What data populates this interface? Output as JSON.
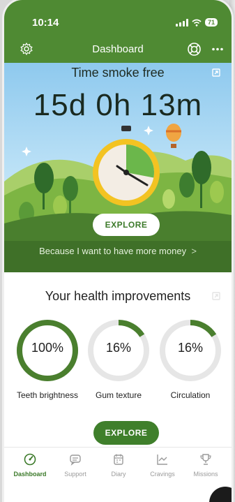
{
  "status_bar": {
    "time": "10:14",
    "battery": "71"
  },
  "header": {
    "title": "Dashboard"
  },
  "hero": {
    "title": "Time smoke free",
    "counter": "15d 0h 13m",
    "explore_label": "EXPLORE",
    "reason": "Because I want to have more money",
    "stopwatch_progress": 0.28
  },
  "health": {
    "title": "Your health improvements",
    "items": [
      {
        "value": "100%",
        "label": "Teeth brightness",
        "progress": 1.0
      },
      {
        "value": "16%",
        "label": "Gum texture",
        "progress": 0.16
      },
      {
        "value": "16%",
        "label": "Circulation",
        "progress": 0.16
      }
    ],
    "explore_label": "EXPLORE"
  },
  "nav": {
    "items": [
      {
        "label": "Dashboard",
        "icon": "dashboard-icon",
        "active": true
      },
      {
        "label": "Support",
        "icon": "chat-icon",
        "active": false
      },
      {
        "label": "Diary",
        "icon": "calendar-icon",
        "active": false
      },
      {
        "label": "Cravings",
        "icon": "chart-icon",
        "active": false
      },
      {
        "label": "Missions",
        "icon": "trophy-icon",
        "active": false
      }
    ]
  },
  "colors": {
    "brand_green": "#4f8a33",
    "ring_green": "#4a7f2e",
    "ring_track": "#e6e6e6"
  }
}
